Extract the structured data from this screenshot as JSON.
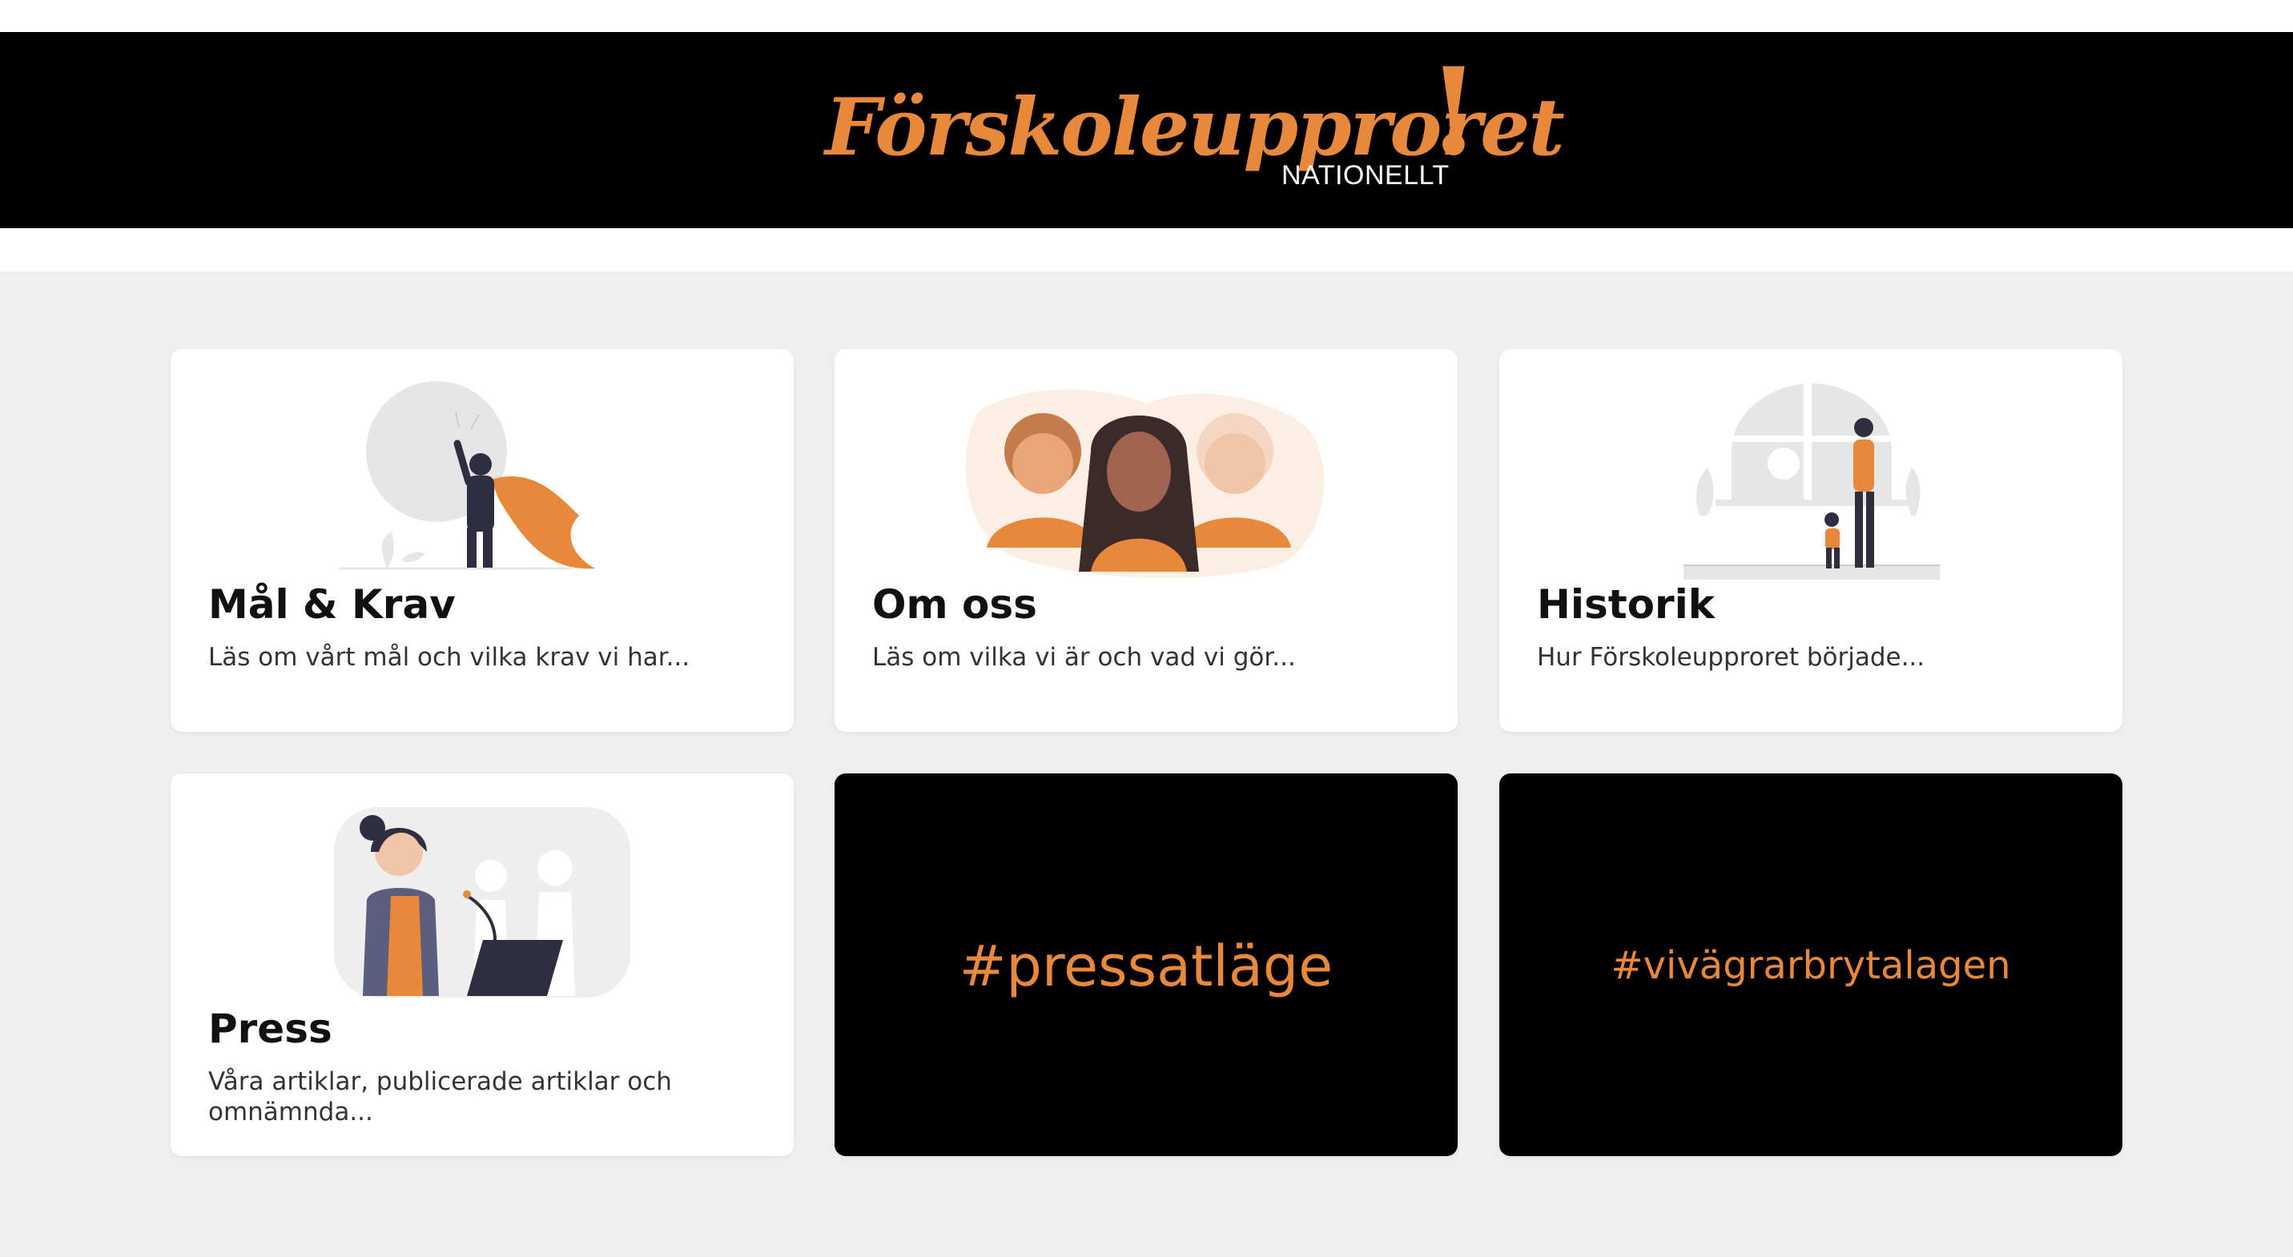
{
  "colors": {
    "accent": "#e8883a",
    "header_bg": "#000000",
    "page_bg": "#efefef",
    "card_bg": "#ffffff",
    "text": "#111111"
  },
  "header": {
    "logo_text": "Förskoleupproret",
    "logo_bang": "!",
    "logo_sub": "NATIONELLT"
  },
  "cards": [
    {
      "title": "Mål & Krav",
      "description": "Läs om vårt mål och vilka krav vi har...",
      "illustration": "superhero-illustration"
    },
    {
      "title": "Om oss",
      "description": "Läs om vilka vi är och vad vi gör...",
      "illustration": "three-women-illustration"
    },
    {
      "title": "Historik",
      "description": "Hur Förskoleupproret började...",
      "illustration": "mother-child-illustration"
    },
    {
      "title": "Press",
      "description": "Våra artiklar, publicerade artiklar och omnämnda...",
      "illustration": "speaker-podium-illustration"
    },
    {
      "hashtag": "#pressatläge"
    },
    {
      "hashtag": "#vivägrarbrytalagen"
    }
  ]
}
